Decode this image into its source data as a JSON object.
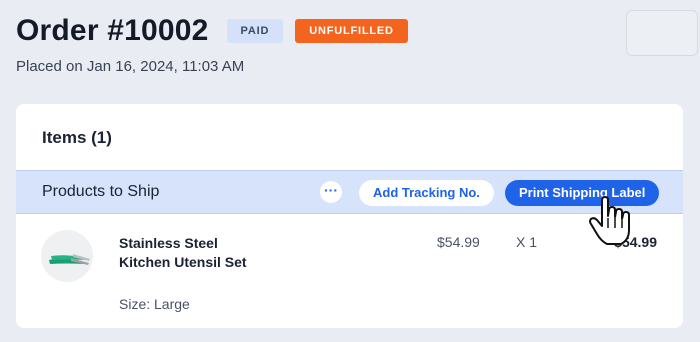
{
  "order": {
    "title": "Order #10002",
    "payment_badge": "PAID",
    "fulfillment_badge": "UNFULFILLED",
    "placed_on": "Placed on Jan 16, 2024, 11:03 AM"
  },
  "items_card": {
    "title": "Items (1)",
    "ship_bar": {
      "label": "Products to Ship",
      "more_label": "···",
      "tracking_button": "Add Tracking No.",
      "print_button": "Print Shipping Label"
    },
    "products": [
      {
        "name": "Stainless Steel Kitchen Utensil Set",
        "option": "Size: Large",
        "price": "$54.99",
        "quantity": "X 1",
        "total": "$54.99"
      }
    ]
  },
  "colors": {
    "accent": "#1e63e8",
    "unfulfilled": "#f5641e",
    "paid_badge_bg": "#d4e1f8",
    "ship_bar_bg": "#d6e3fb",
    "page_bg": "#e9ecf2"
  },
  "icons": {
    "more": "more-dots-icon",
    "cursor": "hand-pointer-icon",
    "product_thumbnail": "kitchen-tongs-image"
  }
}
